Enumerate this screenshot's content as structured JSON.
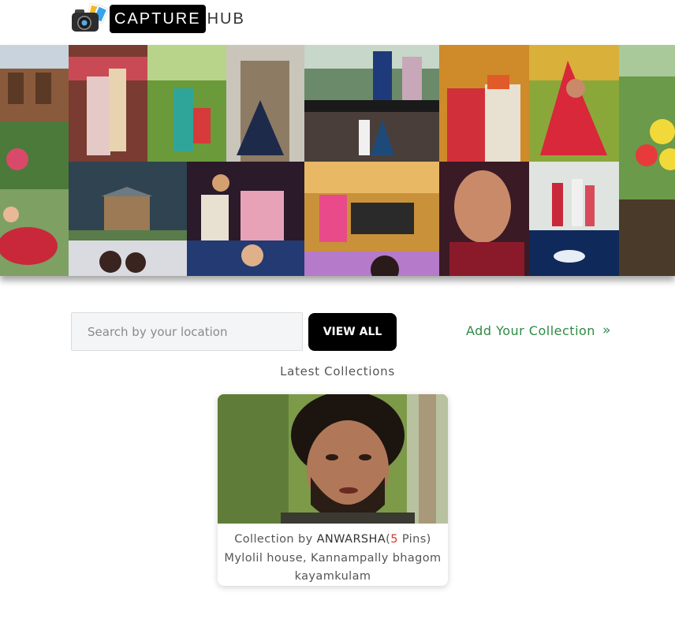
{
  "header": {
    "logo_capture": "CAPTURE",
    "logo_hub": "HUB"
  },
  "search": {
    "placeholder": "Search by your location",
    "value": ""
  },
  "buttons": {
    "view_all": "VIEW ALL",
    "add_collection": "Add Your Collection",
    "add_collection_icon": "double-chevron-right-icon"
  },
  "section": {
    "title": "Latest Collections"
  },
  "collections": [
    {
      "prefix": "Collection by",
      "user": "ANWARSHA",
      "pins_open": "(",
      "pins_count": "5",
      "pins_label": "Pins)",
      "address_line1": "Mylolil house, Kannampally bhagom",
      "address_line2": "kayamkulam"
    }
  ],
  "colors": {
    "accent_green": "#2f8a44",
    "button_black": "#000000",
    "pins_red": "#d9362a"
  }
}
